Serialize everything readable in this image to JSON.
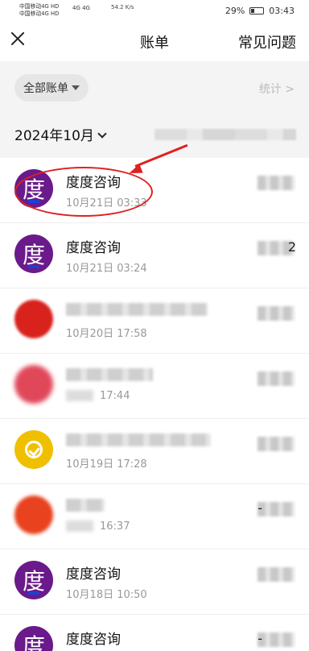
{
  "status_bar": {
    "carrier_1": "中国移动4G HD",
    "carrier_2": "中国移动4G HD",
    "network": "4G 4G",
    "speed": "54.2 K/s",
    "battery": "29%",
    "battery_level": 0.29,
    "time": "03:43"
  },
  "header": {
    "title": "账单",
    "faq_label": "常见问题"
  },
  "filter": {
    "all_bills_label": "全部账单",
    "stats_label": "统计 >"
  },
  "month": {
    "label": "2024年10月"
  },
  "transactions": [
    {
      "name": "度度咨询",
      "time": "10月21日 03:33",
      "avatar": "du",
      "avatar_char": "度",
      "amount": ""
    },
    {
      "name": "度度咨询",
      "time": "10月21日 03:24",
      "avatar": "du",
      "avatar_char": "度",
      "amount": "2"
    },
    {
      "name": "",
      "time": "10月20日 17:58",
      "avatar": "red",
      "avatar_char": "",
      "amount": ""
    },
    {
      "name": "",
      "time": "17:44",
      "avatar": "pink",
      "avatar_char": "",
      "amount": ""
    },
    {
      "name": "",
      "time": "10月19日 17:28",
      "avatar": "yellow",
      "avatar_char": "",
      "amount": ""
    },
    {
      "name": "",
      "time": "16:37",
      "avatar": "orange",
      "avatar_char": "",
      "amount": "-"
    },
    {
      "name": "度度咨询",
      "time": "10月18日 10:50",
      "avatar": "du",
      "avatar_char": "度",
      "amount": ""
    },
    {
      "name": "度度咨询",
      "time": "",
      "avatar": "du",
      "avatar_char": "度",
      "amount": "-"
    }
  ],
  "colors": {
    "annotation": "#e02020",
    "du_avatar": "#6a1a8a",
    "page_bg": "#f4f4f4"
  },
  "icons": {
    "close": "close-icon",
    "dropdown": "triangle-down-icon",
    "month_chevron": "chevron-down-icon",
    "stats_chevron": "chevron-right-icon"
  }
}
